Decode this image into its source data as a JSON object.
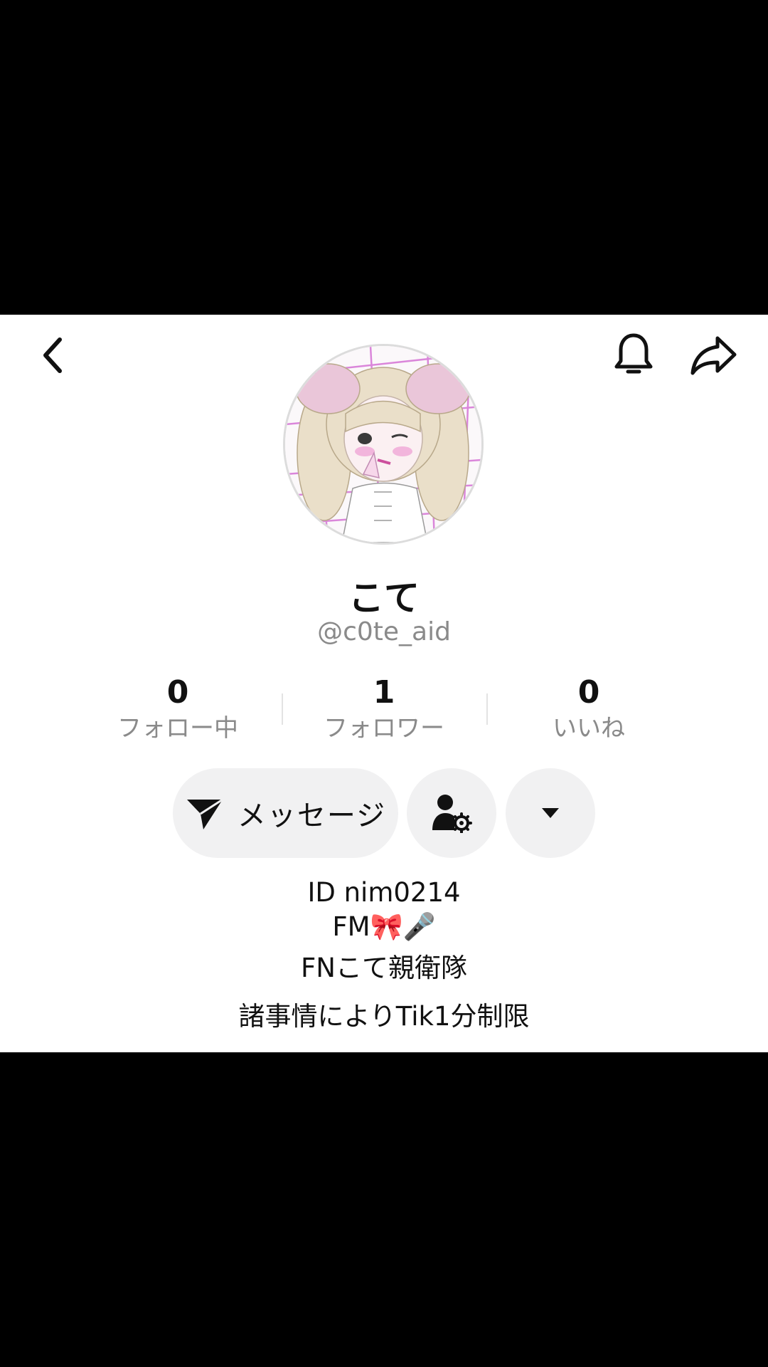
{
  "profile": {
    "display_name": "こて",
    "handle": "@c0te_aid"
  },
  "stats": {
    "following": {
      "count": "0",
      "label": "フォロー中"
    },
    "followers": {
      "count": "1",
      "label": "フォロワー"
    },
    "likes": {
      "count": "0",
      "label": "いいね"
    }
  },
  "actions": {
    "message_label": "メッセージ"
  },
  "bio": {
    "line1": "ID nim0214",
    "line2": "FM🎀🎤",
    "line3": "FNこて親衛隊",
    "line4": "諸事情によりTik1分制限"
  },
  "icons": {
    "back": "chevron-left-icon",
    "bell": "bell-icon",
    "share": "share-arrow-icon",
    "message": "send-icon",
    "friend_settings": "user-settings-icon",
    "more": "caret-down-icon"
  },
  "colors": {
    "surface": "#ffffff",
    "letterbox": "#000000",
    "button_bg": "#f1f1f2",
    "secondary_text": "#8a8a8a",
    "primary_text": "#111111"
  }
}
